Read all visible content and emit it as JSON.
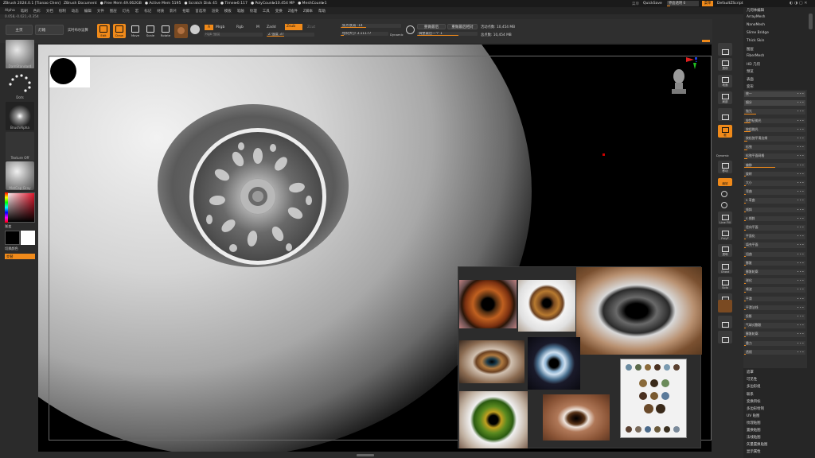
{
  "titlebar": {
    "app": "ZBrush 2024.0.1 [Tianao Chen]",
    "doc": "ZBrush Document",
    "free_mem": "Free Mem 49.062GB",
    "active_mem": "Active Mem 5195",
    "scratch": "Scratch Disk 45",
    "timer": "Timer▸0.117",
    "polycount": "PolyCount▸10.454 MP",
    "meshcount": "MeshCount▸1"
  },
  "topright": {
    "menu_label": "菜单",
    "quicksave": "QuickSave",
    "transparency": "界面透明 0",
    "menus_btn": "菜单",
    "default_script": "DefaultZScript"
  },
  "menubar": [
    "Alpha",
    "笔刷",
    "色彩",
    "文档",
    "绘制",
    "动态",
    "编辑",
    "文件",
    "图层",
    "灯光",
    "宏",
    "标记",
    "材质",
    "影片",
    "拾取",
    "首选项",
    "渲染",
    "模板",
    "笔触",
    "纹理",
    "工具",
    "变换",
    "Z插件",
    "Z脚本",
    "帮助"
  ],
  "coords": "0.058,-0.021,-0.354",
  "toolbar": {
    "home": "主页",
    "lightbox": "灯箱",
    "live_boolean": "实时布尔运算",
    "edit": "Edit",
    "draw": "Draw",
    "move": "Move",
    "scale": "Scale",
    "rotate": "Rotate",
    "a_label": "A",
    "mrgb": "Mrgb",
    "rgb": "Rgb",
    "m": "M",
    "zadd": "Zadd",
    "zsub": "Zsub",
    "zcut": "Zcut",
    "rgb_intensity": "Rgb 强度",
    "z_intensity": "Z 强度 37",
    "focal_shift": "焦点衰减 -14",
    "draw_size": "绘制大小 3.11177",
    "dynamic": "Dynamic",
    "active_points": "活动点数: 10,454 MB",
    "total_points": "总点数: 10,454 MB",
    "history_max": "重做最后",
    "history_rel": "重做最后相对",
    "adjust_last": "调整最后一个 1"
  },
  "leftshelf": {
    "brush": "DamStandard",
    "stroke": "Dots",
    "alpha": "BrushAlpha",
    "texture": "Texture Off",
    "material": "MatCap Gray",
    "gradient": "渐变",
    "switch_color": "切换颜色",
    "alternate": "交替"
  },
  "rightshelf": {
    "b1": "",
    "b2": "",
    "persp": "透视",
    "floor": "地面",
    "local": "局部",
    "frame": "框",
    "dynamic": "Dynamic",
    "move": "移动",
    "scale": "缩放",
    "rotate": "旋转",
    "line_fill": "Line Fill",
    "polyf": "PolyF",
    "transp": "透明",
    "ghost": "Ghost",
    "solo": "Solo",
    "xpose": "Xpose"
  },
  "palette": {
    "top_items": [
      "几何体编辑",
      "ArrayMesh",
      "NanoMesh",
      "Slime Bridge",
      "Thick Skin",
      "图层",
      "FiberMesh",
      "HD 几何",
      "预览",
      "表面",
      "变形"
    ],
    "sub_rows": [
      {
        "label": "统一",
        "kind": "head"
      },
      {
        "label": "细分",
        "kind": "head"
      },
      {
        "label": "抛光",
        "kind": "slider",
        "fill": 0.2
      },
      {
        "label": "按特征抛光",
        "kind": "slider",
        "fill": 0.1
      },
      {
        "label": "按组抛光",
        "kind": "slider",
        "fill": 0.1
      },
      {
        "label": "按松弛平滑边缘",
        "kind": "slider",
        "fill": 0.05
      },
      {
        "label": "松弛",
        "kind": "slider",
        "fill": 0.05
      },
      {
        "label": "松弛平面网格",
        "kind": "slider",
        "fill": 0.05
      },
      {
        "label": "偏移",
        "kind": "slider",
        "fill": 0.5
      },
      {
        "label": "旋转",
        "kind": "slider",
        "fill": 0.0
      },
      {
        "label": "大小",
        "kind": "slider",
        "fill": 0.0
      },
      {
        "label": "弯曲",
        "kind": "slider",
        "fill": 0.0
      },
      {
        "label": "S 弯曲",
        "kind": "slider",
        "fill": 0.0
      },
      {
        "label": "倾斜",
        "kind": "slider",
        "fill": 0.0
      },
      {
        "label": "S 倾斜",
        "kind": "slider",
        "fill": 0.0
      },
      {
        "label": "径向平面",
        "kind": "slider",
        "fill": 0.0
      },
      {
        "label": "平面化",
        "kind": "slider",
        "fill": 0.0
      },
      {
        "label": "填充平面",
        "kind": "slider",
        "fill": 0.0
      },
      {
        "label": "扭曲",
        "kind": "slider",
        "fill": 0.0
      },
      {
        "label": "膨胀",
        "kind": "slider",
        "fill": 0.0
      },
      {
        "label": "膨胀轮廓",
        "kind": "slider",
        "fill": 0.0
      },
      {
        "label": "球化",
        "kind": "slider",
        "fill": 0.0
      },
      {
        "label": "噪波",
        "kind": "slider",
        "fill": 0.0
      },
      {
        "label": "平滑",
        "kind": "slider",
        "fill": 0.0
      },
      {
        "label": "平滑法线",
        "kind": "slider",
        "fill": 0.0
      },
      {
        "label": "投影",
        "kind": "slider",
        "fill": 0.0
      },
      {
        "label": "气球式膨胀",
        "kind": "slider",
        "fill": 0.0
      },
      {
        "label": "膨胀轮廓",
        "kind": "slider",
        "fill": 0.0
      },
      {
        "label": "重力",
        "kind": "slider",
        "fill": 0.0
      },
      {
        "label": "透视",
        "kind": "slider",
        "fill": 0.0
      }
    ],
    "bottom_items": [
      "遮罩",
      "可见性",
      "多边形组",
      "联系",
      "变换目标",
      "多边形绘制",
      "UV 贴图",
      "纹理贴图",
      "置换贴图",
      "法线贴图",
      "矢量置换贴图",
      "显示属性"
    ]
  },
  "refboard": {
    "images": [
      "eye-closeup-brown",
      "eye-hazel",
      "eye-dark-large",
      "eye-amber",
      "eye-blue-dark",
      "eye-reference-sheet",
      "eye-green",
      "eye-face-brown"
    ]
  }
}
